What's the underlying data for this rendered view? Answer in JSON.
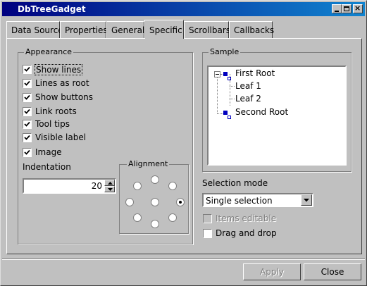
{
  "window": {
    "title": "DbTreeGadget"
  },
  "tabs": [
    "Data Source",
    "Properties",
    "General",
    "Specific",
    "Scrollbars",
    "Callbacks"
  ],
  "appearance": {
    "legend": "Appearance",
    "options": [
      {
        "label": "Show lines",
        "checked": true
      },
      {
        "label": "Lines as root",
        "checked": true
      },
      {
        "label": "Show buttons",
        "checked": true
      },
      {
        "label": "Link roots",
        "checked": true
      },
      {
        "label": "Tool tips",
        "checked": true
      },
      {
        "label": "Visible label",
        "checked": true
      },
      {
        "label": "Image",
        "checked": true
      }
    ],
    "indentation_label": "Indentation",
    "indentation_value": "20"
  },
  "alignment": {
    "legend": "Alignment"
  },
  "sample": {
    "legend": "Sample",
    "nodes": [
      "First Root",
      "Leaf 1",
      "Leaf 2",
      "Second Root"
    ]
  },
  "selection": {
    "label": "Selection mode",
    "value": "Single selection",
    "items_editable": "Items editable",
    "drag_and_drop": "Drag and drop"
  },
  "buttons": {
    "apply": "Apply",
    "close": "Close"
  }
}
